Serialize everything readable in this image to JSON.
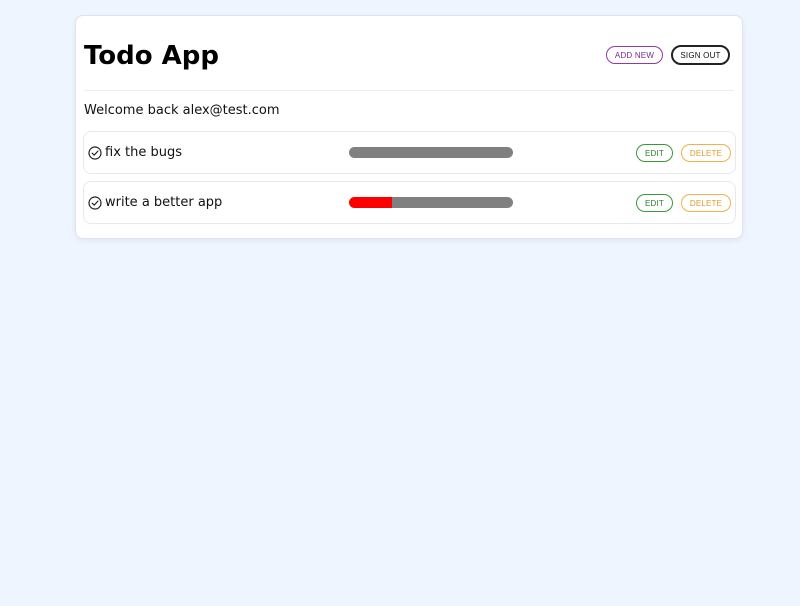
{
  "app": {
    "title": "Todo App",
    "add_new_label": "ADD NEW",
    "sign_out_label": "SIGN OUT",
    "welcome_text": "Welcome back alex@test.com"
  },
  "todos": [
    {
      "label": "fix the bugs",
      "progress": 0,
      "edit_label": "EDIT",
      "delete_label": "DELETE"
    },
    {
      "label": "write a better app",
      "progress": 0.26,
      "edit_label": "EDIT",
      "delete_label": "DELETE"
    }
  ],
  "colors": {
    "background": "#eff5ff",
    "add_new": "#8e3ba3",
    "edit": "#3a9a3a",
    "delete": "#f0b24a",
    "progress_track": "#808080",
    "progress_fill": "#ff0000"
  },
  "icons": {
    "todo_check": "check-circle-icon"
  }
}
